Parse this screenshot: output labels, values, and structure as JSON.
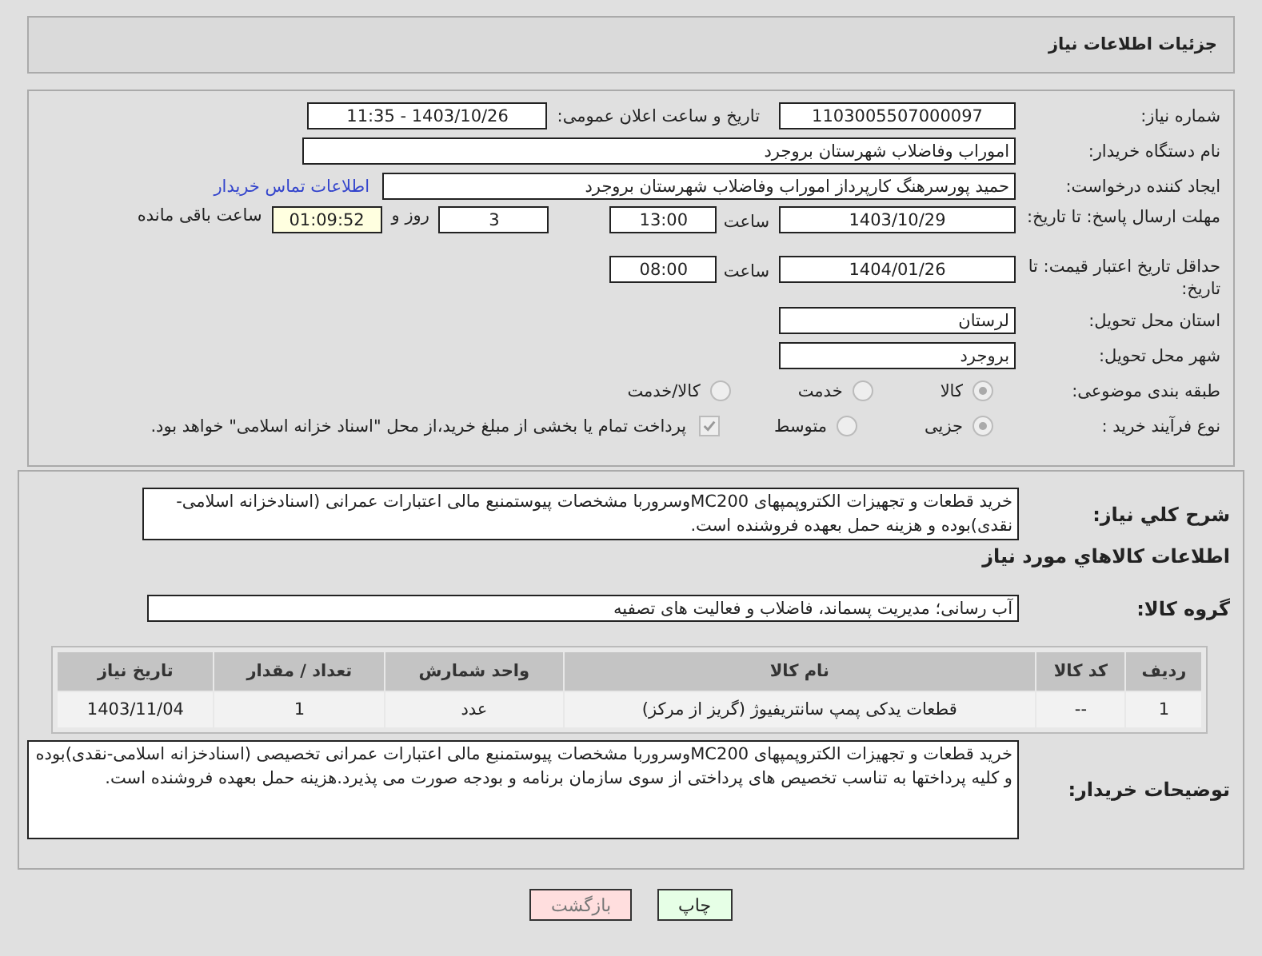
{
  "header": {
    "title": "جزئیات اطلاعات نیاز"
  },
  "fields": {
    "need_number": {
      "label": "شماره نیاز:",
      "value": "1103005507000097"
    },
    "announce": {
      "label": "تاریخ و ساعت اعلان عمومی:",
      "value": "1403/10/26 - 11:35"
    },
    "buyer_org": {
      "label": "نام دستگاه خریدار:",
      "value": "اموراب وفاضلاب شهرستان بروجرد"
    },
    "creator": {
      "label": "ایجاد کننده درخواست:",
      "value": "حمید پورسرهنگ کارپرداز اموراب وفاضلاب شهرستان بروجرد",
      "link": "اطلاعات تماس خریدار"
    },
    "reply_deadline": {
      "label": "مهلت ارسال پاسخ: تا تاریخ:",
      "date": "1403/10/29",
      "time_label": "ساعت",
      "time": "13:00",
      "days": "3",
      "days_label": "روز و",
      "remaining": "01:09:52",
      "remaining_label": "ساعت باقی مانده"
    },
    "validity_deadline": {
      "label": "حداقل تاریخ اعتبار قیمت: تا تاریخ:",
      "date": "1404/01/26",
      "time_label": "ساعت",
      "time": "08:00"
    },
    "province": {
      "label": "استان محل تحویل:",
      "value": "لرستان"
    },
    "city": {
      "label": "شهر محل تحویل:",
      "value": "بروجرد"
    },
    "category": {
      "label": "طبقه بندی موضوعی:",
      "options": [
        {
          "label": "کالا",
          "selected": true
        },
        {
          "label": "خدمت",
          "selected": false
        },
        {
          "label": "کالا/خدمت",
          "selected": false
        }
      ]
    },
    "process": {
      "label": "نوع فرآیند خرید :",
      "options": [
        {
          "label": "جزیی",
          "selected": true
        },
        {
          "label": "متوسط",
          "selected": false
        }
      ],
      "payment": {
        "checked": true,
        "text": "پرداخت تمام یا بخشی از مبلغ خرید،از محل \"اسناد خزانه اسلامی\" خواهد بود."
      }
    }
  },
  "description": {
    "label": "شرح کلي نیاز:",
    "value": "خرید قطعات و تجهیزات الکتروپمپهای MC200وسروربا مشخصات پیوستمنبع مالی اعتبارات عمرانی (اسنادخزانه اسلامی-نقدی)بوده و هزینه حمل بعهده فروشنده است."
  },
  "goods_title": "اطلاعات کالاهاي مورد نیاز",
  "group": {
    "label": "گروه کالا:",
    "value": "آب رسانی؛ مدیریت پسماند، فاضلاب و فعالیت های تصفیه"
  },
  "table": {
    "columns": [
      "ردیف",
      "کد کالا",
      "نام کالا",
      "واحد شمارش",
      "تعداد / مقدار",
      "تاریخ نیاز"
    ],
    "rows": [
      [
        "1",
        "--",
        "قطعات یدکی پمپ سانتریفیوژ (گریز از مرکز)",
        "عدد",
        "1",
        "1403/11/04"
      ]
    ]
  },
  "notes": {
    "label": "توضیحات خریدار:",
    "value": "خرید قطعات و تجهیزات الکتروپمپهای MC200وسروربا مشخصات پیوستمنبع مالی اعتبارات عمرانی تخصیصی (اسنادخزانه اسلامی-نقدی)بوده و کلیه پرداختها به تناسب تخصیص های پرداختی از سوی سازمان برنامه و بودجه صورت می پذیرد.هزینه حمل بعهده فروشنده است."
  },
  "buttons": [
    {
      "label": "چاپ",
      "kind": "print"
    },
    {
      "label": "بازگشت",
      "kind": "back"
    }
  ]
}
